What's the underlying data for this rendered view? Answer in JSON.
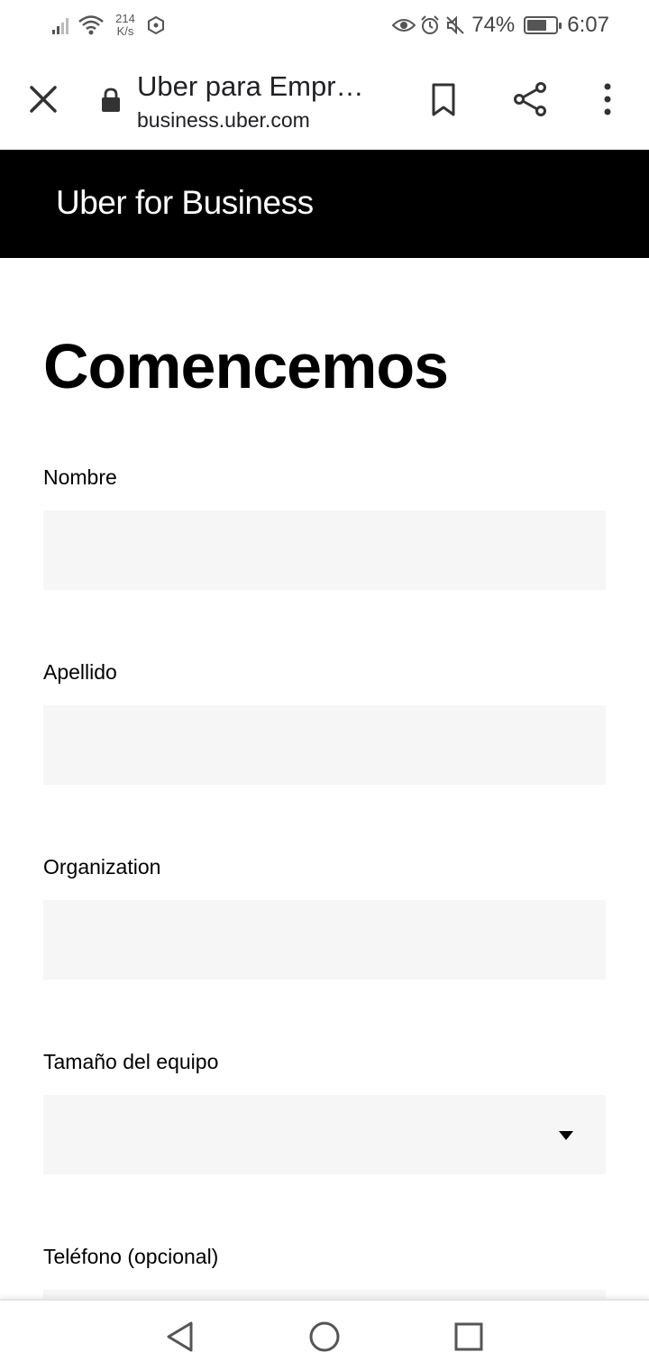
{
  "status_bar": {
    "speed_value": "214",
    "speed_unit": "K/s",
    "battery_percent": "74%",
    "battery_level": 0.74,
    "time": "6:07",
    "icons": [
      "signal-icon",
      "wifi-icon",
      "hexagon-icon",
      "eye-icon",
      "alarm-icon",
      "mute-icon",
      "battery-icon"
    ]
  },
  "browser": {
    "page_title": "Uber para Empr…",
    "url": "business.uber.com",
    "icons": [
      "close-icon",
      "lock-icon",
      "bookmark-icon",
      "share-icon",
      "more-vert-icon"
    ]
  },
  "header": {
    "brand": "Uber for Business"
  },
  "form": {
    "title": "Comencemos",
    "fields": [
      {
        "label": "Nombre",
        "value": ""
      },
      {
        "label": "Apellido",
        "value": ""
      },
      {
        "label": "Organization",
        "value": ""
      },
      {
        "label": "Tamaño del equipo",
        "value": ""
      },
      {
        "label": "Teléfono (opcional)",
        "value": ""
      }
    ]
  },
  "nav": {
    "icons": [
      "back-triangle-icon",
      "home-circle-icon",
      "recents-square-icon"
    ]
  },
  "colors": {
    "header_bg": "#000000",
    "input_bg": "#f6f6f6",
    "text": "#000000"
  }
}
